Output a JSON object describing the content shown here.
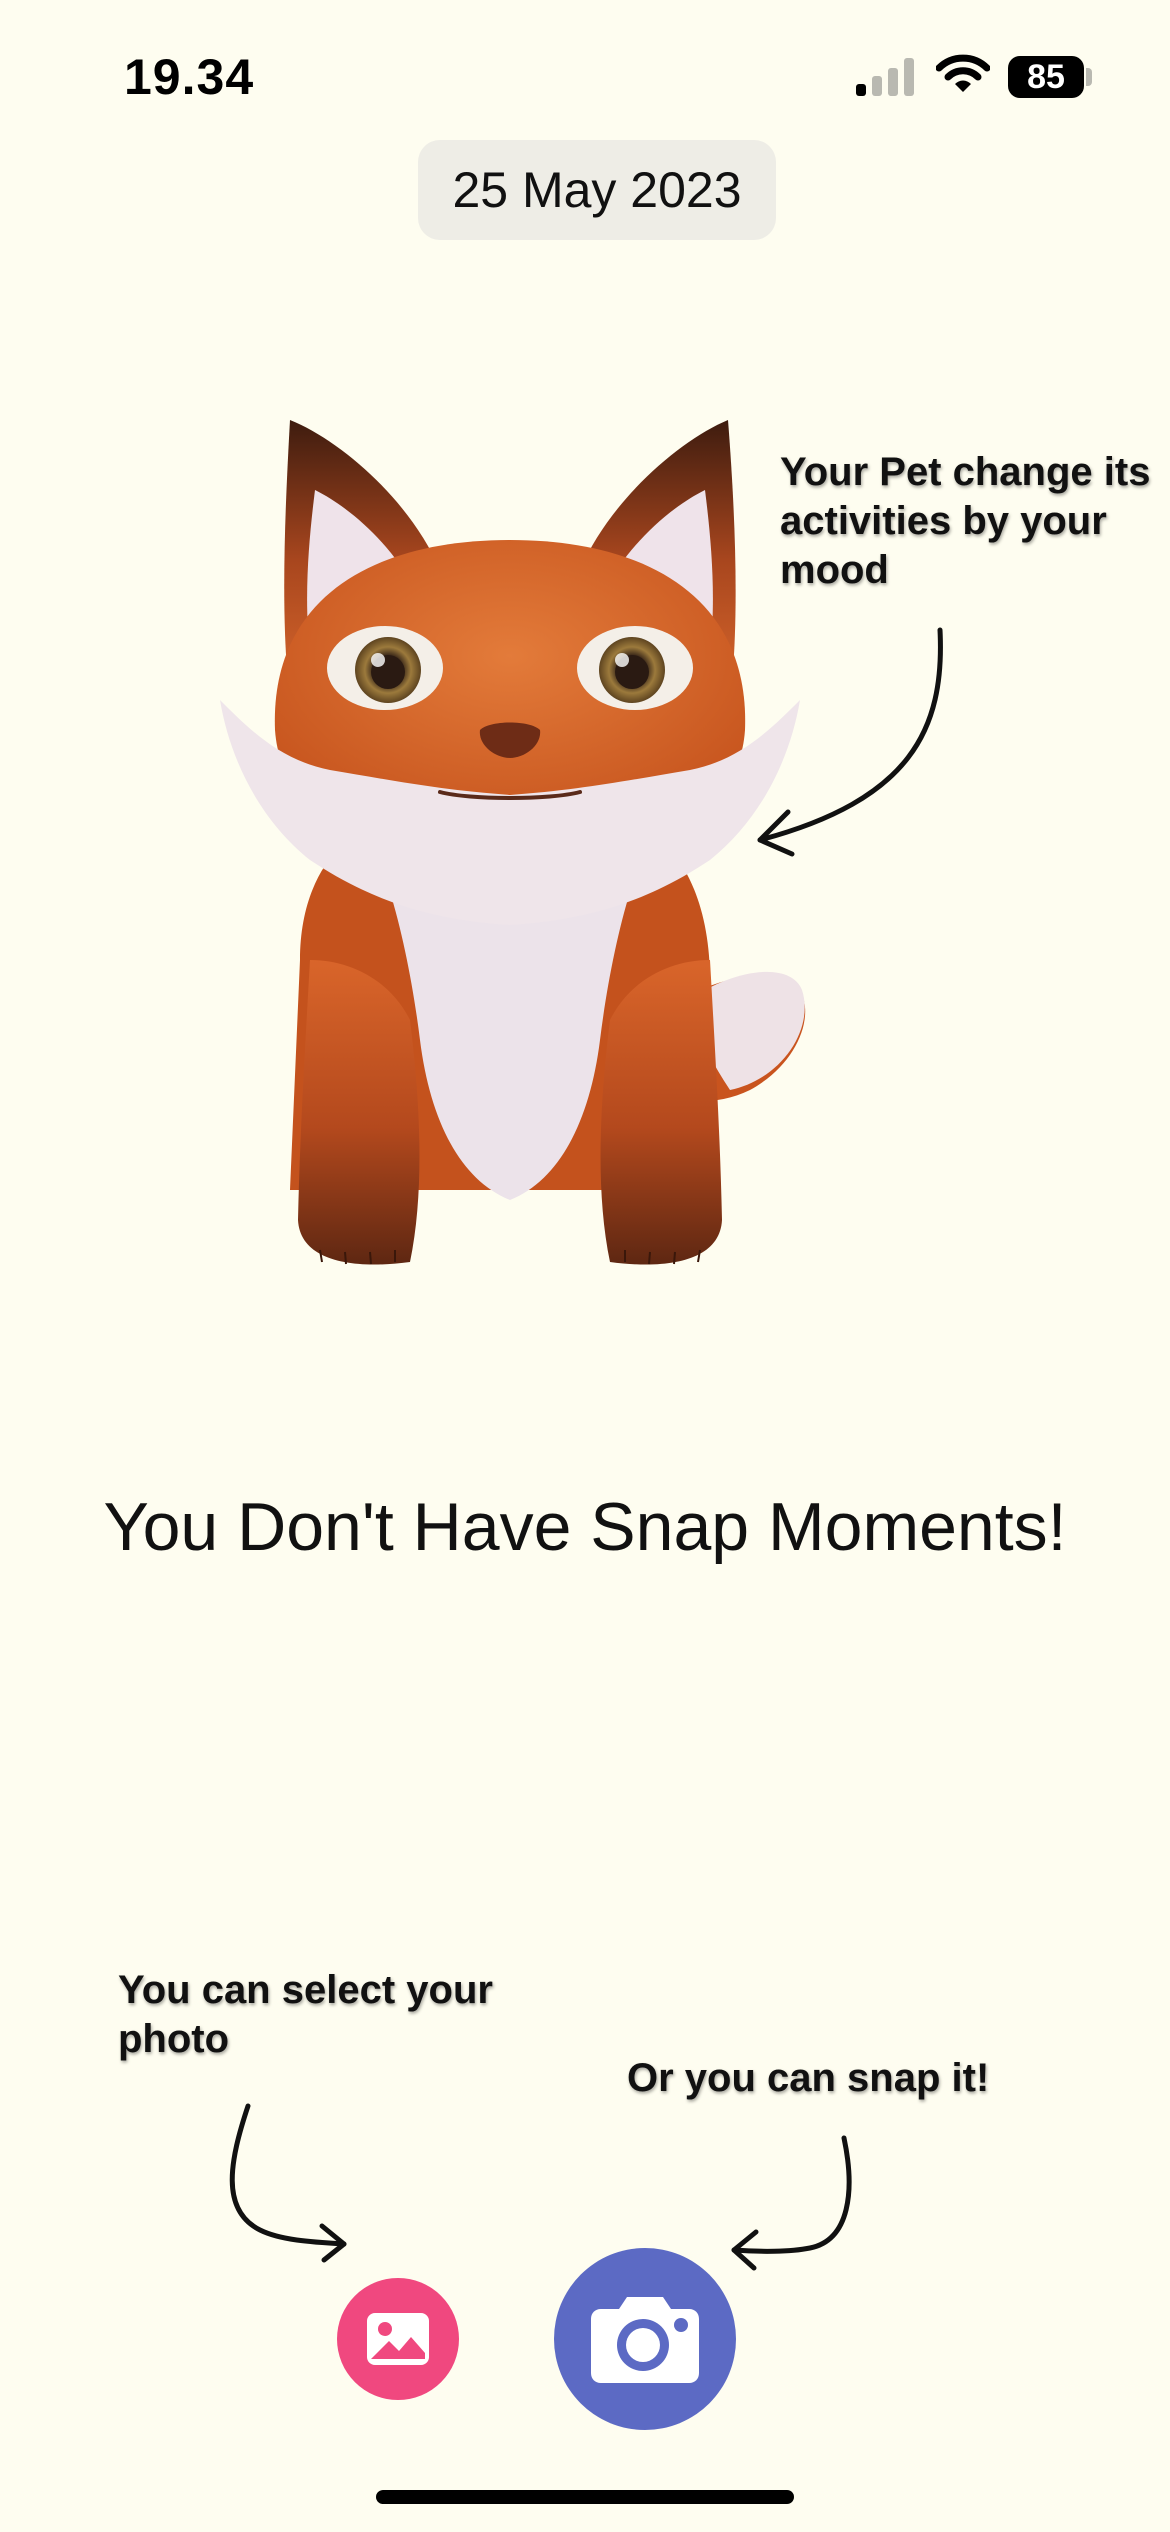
{
  "status_bar": {
    "time": "19.34",
    "battery": "85"
  },
  "header": {
    "date": "25 May 2023"
  },
  "pet": {
    "icon": "fox-pet-illustration",
    "hint": "Your Pet change its activities by your mood"
  },
  "empty_state": {
    "title": "You Don't Have Snap Moments!"
  },
  "actions": {
    "select_hint": "You can select your photo",
    "snap_hint": "Or you can snap it!",
    "gallery_icon": "image-icon",
    "camera_icon": "camera-icon"
  },
  "colors": {
    "background": "#fefdf0",
    "gallery_button": "#f0487f",
    "camera_button": "#5c6ac4",
    "date_pill": "#eeede6"
  }
}
